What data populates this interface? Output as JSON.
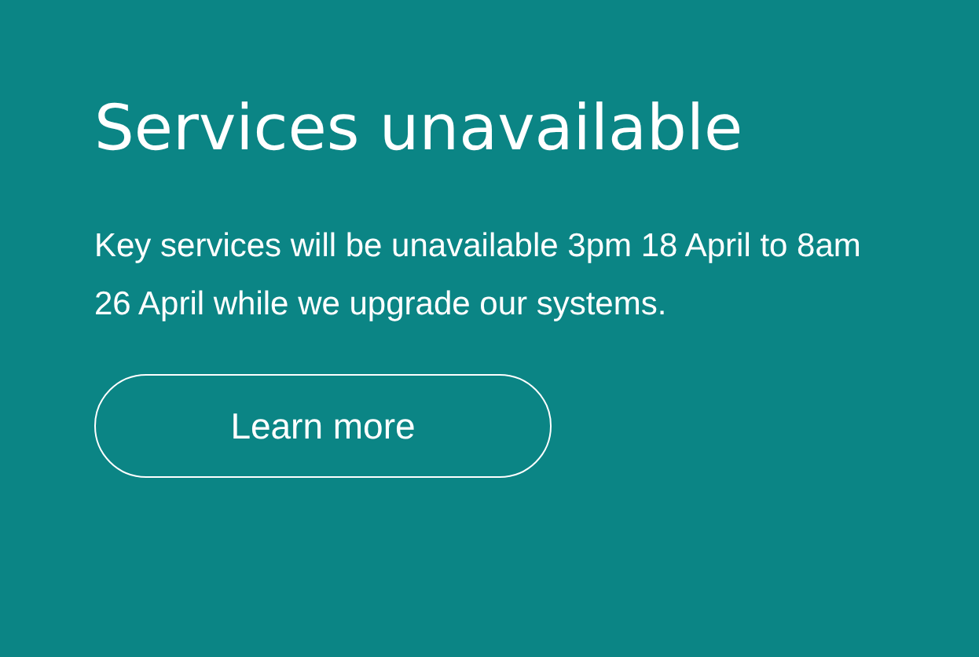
{
  "notice": {
    "title": "Services unavailable",
    "message": "Key services will be unavailable 3pm 18 April to 8am 26 April while we upgrade our systems.",
    "button": "Learn more"
  }
}
